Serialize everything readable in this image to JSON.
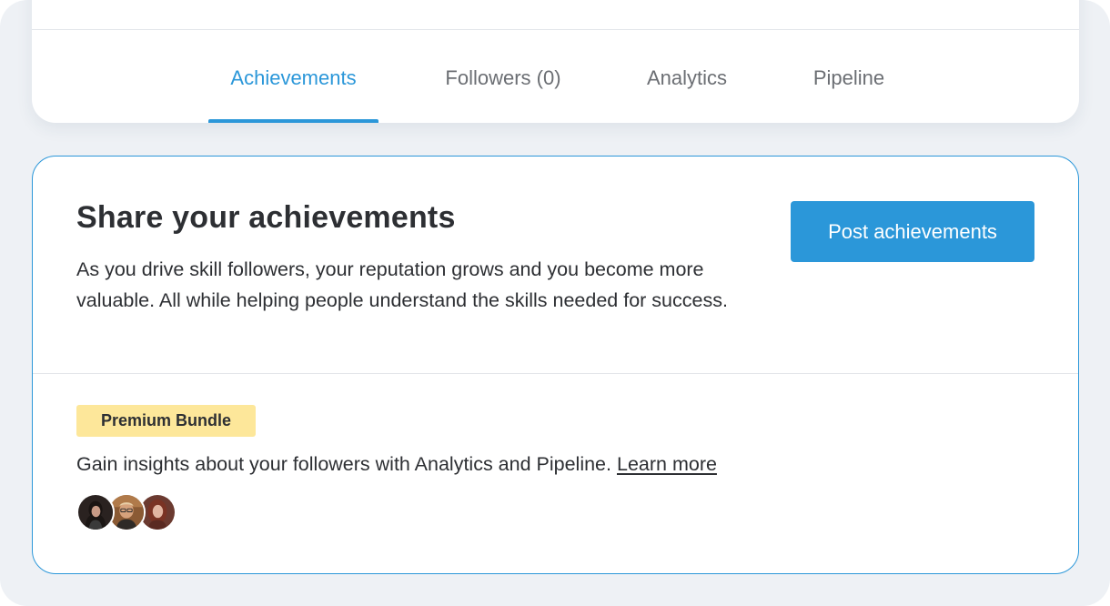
{
  "tabs": [
    {
      "label": "Achievements",
      "active": true
    },
    {
      "label": "Followers (0)",
      "active": false
    },
    {
      "label": "Analytics",
      "active": false
    },
    {
      "label": "Pipeline",
      "active": false
    }
  ],
  "achievements_card": {
    "title": "Share your achievements",
    "description": "As you drive skill followers, your reputation grows and you become more valuable. All while helping people understand the skills needed for success.",
    "post_button_label": "Post achievements"
  },
  "premium": {
    "badge_label": "Premium Bundle",
    "text": "Gain insights about your followers with Analytics and Pipeline.",
    "link_label": "Learn more",
    "avatars": [
      "avatar-woman-dark-hair",
      "avatar-man-glasses",
      "avatar-woman-auburn-hair"
    ]
  },
  "colors": {
    "accent": "#2b97d9",
    "badge_background": "#fde79a",
    "page_background": "#eef1f5",
    "text": "#2d2f33",
    "tab_inactive": "#6b6e73"
  }
}
